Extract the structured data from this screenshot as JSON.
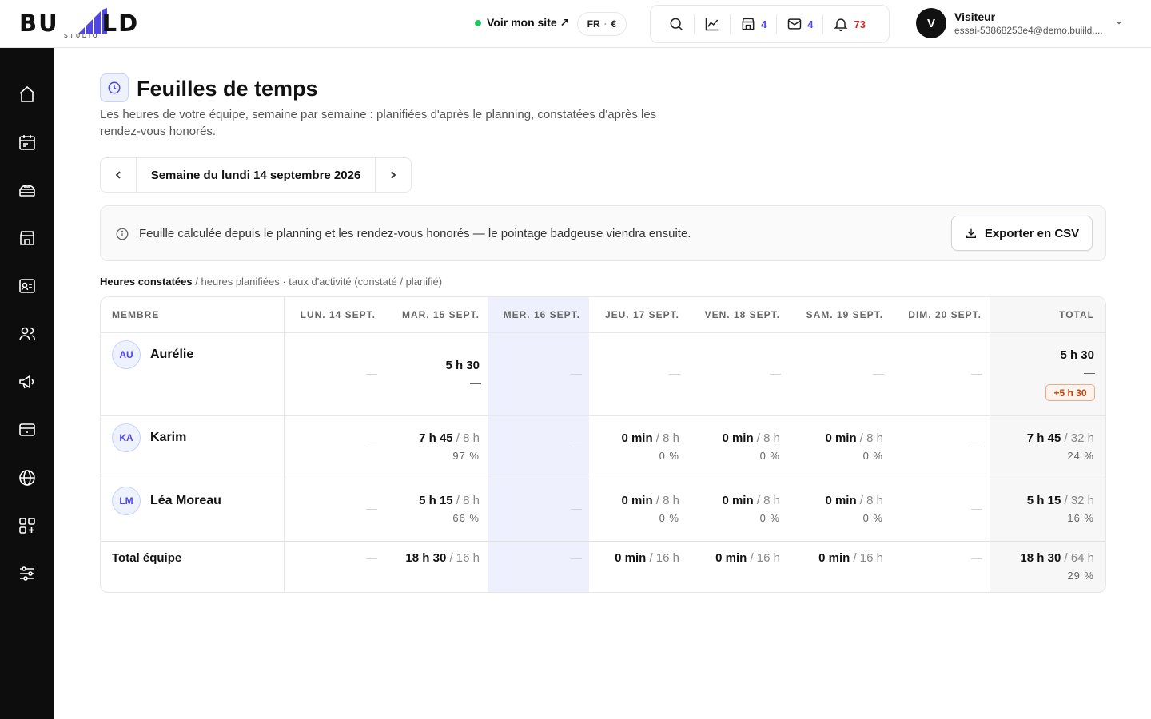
{
  "header": {
    "logo_text": "BUILD",
    "logo_sub": "STUDIO",
    "visit_site": "Voir mon site ↗",
    "lang": "FR",
    "currency": "€",
    "tools": [
      {
        "name": "search",
        "count": ""
      },
      {
        "name": "analytics",
        "count": ""
      },
      {
        "name": "store",
        "count": "4"
      },
      {
        "name": "mail",
        "count": "4"
      },
      {
        "name": "notifications",
        "count": "73"
      }
    ],
    "user_initial": "V",
    "user_name": "Visiteur",
    "user_email": "essai-53868253e4@demo.buiild...."
  },
  "page": {
    "title": "Feuilles de temps",
    "subtitle": "Les heures de votre équipe, semaine par semaine : planifiées d'après le planning, constatées d'après les rendez-vous honorés.",
    "week_label": "Semaine du lundi 14 septembre 2026",
    "info_text": "Feuille calculée depuis le planning et les rendez-vous honorés — le pointage badgeuse viendra ensuite.",
    "export_label": "Exporter en CSV",
    "legend_bold": "Heures constatées",
    "legend_rest": " / heures planifiées · taux d'activité (constaté / planifié)"
  },
  "table": {
    "headers": {
      "member": "MEMBRE",
      "d1": "LUN. 14 SEPT.",
      "d2": "MAR. 15 SEPT.",
      "d3": "MER. 16 SEPT.",
      "d4": "JEU. 17 SEPT.",
      "d5": "VEN. 18 SEPT.",
      "d6": "SAM. 19 SEPT.",
      "d7": "DIM. 20 SEPT.",
      "total": "TOTAL"
    },
    "rows": [
      {
        "initials": "AU",
        "name": "Aurélie",
        "d2_actual": "5 h 30",
        "total_actual": "5 h 30",
        "total_delta": "+5 h 30"
      },
      {
        "initials": "KA",
        "name": "Karim",
        "d2_actual": "7 h 45",
        "d2_planned": " / 8 h",
        "d2_pct": "97 %",
        "d4_actual": "0 min",
        "d4_planned": " / 8 h",
        "d4_pct": "0 %",
        "d5_actual": "0 min",
        "d5_planned": " / 8 h",
        "d5_pct": "0 %",
        "d6_actual": "0 min",
        "d6_planned": " / 8 h",
        "d6_pct": "0 %",
        "total_actual": "7 h 45",
        "total_planned": " / 32 h",
        "total_pct": "24 %"
      },
      {
        "initials": "LM",
        "name": "Léa Moreau",
        "d2_actual": "5 h 15",
        "d2_planned": " / 8 h",
        "d2_pct": "66 %",
        "d4_actual": "0 min",
        "d4_planned": " / 8 h",
        "d4_pct": "0 %",
        "d5_actual": "0 min",
        "d5_planned": " / 8 h",
        "d5_pct": "0 %",
        "d6_actual": "0 min",
        "d6_planned": " / 8 h",
        "d6_pct": "0 %",
        "total_actual": "5 h 15",
        "total_planned": " / 32 h",
        "total_pct": "16 %"
      }
    ],
    "footer": {
      "label": "Total équipe",
      "d2_actual": "18 h 30",
      "d2_planned": " / 16 h",
      "d4_actual": "0 min",
      "d4_planned": " / 16 h",
      "d5_actual": "0 min",
      "d5_planned": " / 16 h",
      "d6_actual": "0 min",
      "d6_planned": " / 16 h",
      "total_actual": "18 h 30",
      "total_planned": " / 64 h",
      "total_pct": "29 %"
    }
  },
  "sidebar": {
    "items": [
      "home-icon",
      "calendar-icon",
      "services-icon",
      "store-icon",
      "contacts-icon",
      "team-icon",
      "marketing-icon",
      "payments-icon",
      "website-icon",
      "apps-icon",
      "settings-icon"
    ]
  },
  "colors": {
    "accent": "#4f46e5",
    "highlight_column": "#eef1fd",
    "alert": "#dc2626",
    "positive_delta": "#c2410c",
    "online": "#22c55e"
  }
}
